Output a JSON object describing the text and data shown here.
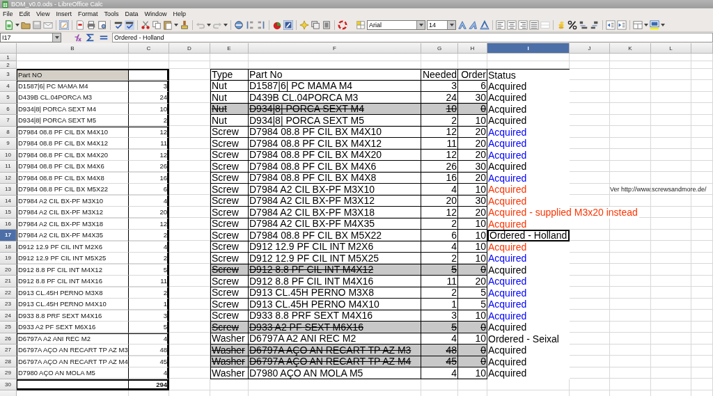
{
  "window": {
    "title": "BOM_v0.0.ods - LibreOffice Calc"
  },
  "menu": [
    "File",
    "Edit",
    "View",
    "Insert",
    "Format",
    "Tools",
    "Data",
    "Window",
    "Help"
  ],
  "formatting": {
    "font": "Arial",
    "size": "14"
  },
  "formula_bar": {
    "cell": "I17",
    "value": "Ordered - Holland"
  },
  "columns": [
    {
      "label": "B",
      "selected": false
    },
    {
      "label": "C",
      "selected": false
    },
    {
      "label": "D",
      "selected": false
    },
    {
      "label": "E",
      "selected": false
    },
    {
      "label": "F",
      "selected": false
    },
    {
      "label": "G",
      "selected": false
    },
    {
      "label": "H",
      "selected": false
    },
    {
      "label": "I",
      "selected": true
    },
    {
      "label": "J",
      "selected": false
    },
    {
      "label": "K",
      "selected": false
    },
    {
      "label": "L",
      "selected": false
    }
  ],
  "rows": [
    {
      "label": "1",
      "selected": false
    },
    {
      "label": "2",
      "selected": false
    },
    {
      "label": "3",
      "selected": false
    },
    {
      "label": "4",
      "selected": false
    },
    {
      "label": "5",
      "selected": false
    },
    {
      "label": "6",
      "selected": false
    },
    {
      "label": "7",
      "selected": false
    },
    {
      "label": "8",
      "selected": false
    },
    {
      "label": "9",
      "selected": false
    },
    {
      "label": "10",
      "selected": false
    },
    {
      "label": "11",
      "selected": false
    },
    {
      "label": "12",
      "selected": false
    },
    {
      "label": "13",
      "selected": false
    },
    {
      "label": "14",
      "selected": false
    },
    {
      "label": "15",
      "selected": false
    },
    {
      "label": "16",
      "selected": false
    },
    {
      "label": "17",
      "selected": true
    },
    {
      "label": "18",
      "selected": false
    },
    {
      "label": "19",
      "selected": false
    },
    {
      "label": "20",
      "selected": false
    },
    {
      "label": "21",
      "selected": false
    },
    {
      "label": "22",
      "selected": false
    },
    {
      "label": "23",
      "selected": false
    },
    {
      "label": "24",
      "selected": false
    },
    {
      "label": "25",
      "selected": false
    },
    {
      "label": "26",
      "selected": false
    },
    {
      "label": "27",
      "selected": false
    },
    {
      "label": "28",
      "selected": false
    },
    {
      "label": "29",
      "selected": false
    },
    {
      "label": "30",
      "selected": false
    }
  ],
  "parts_list": {
    "header": "Part NO",
    "groups": [
      [
        {
          "part": "D1587|6| PC MAMA M4",
          "qty": "3"
        },
        {
          "part": "D439B CL.04PORCA M3",
          "qty": "24"
        },
        {
          "part": "D934|8| PORCA SEXT M4",
          "qty": "10"
        },
        {
          "part": "D934|8| PORCA SEXT M5",
          "qty": "2"
        }
      ],
      [
        {
          "part": "D7984 08.8 PF CIL BX M4X10",
          "qty": "12"
        },
        {
          "part": "D7984 08.8 PF CIL BX M4X12",
          "qty": "11"
        },
        {
          "part": "D7984 08.8 PF CIL BX M4X20",
          "qty": "12"
        },
        {
          "part": "D7984 08.8 PF CIL BX M4X6",
          "qty": "26"
        },
        {
          "part": "D7984 08.8 PF CIL BX M4X8",
          "qty": "16"
        },
        {
          "part": "D7984 08.8 PF CIL BX M5X22",
          "qty": "6"
        },
        {
          "part": "D7984 A2 CIL BX-PF M3X10",
          "qty": "4"
        },
        {
          "part": "D7984 A2 CIL BX-PF M3X12",
          "qty": "20"
        },
        {
          "part": "D7984 A2 CIL BX-PF M3X18",
          "qty": "12"
        },
        {
          "part": "D7984 A2 CIL BX-PF M4X35",
          "qty": "2"
        },
        {
          "part": "D912 12.9 PF CIL INT M2X6",
          "qty": "4"
        },
        {
          "part": "D912 12.9 PF CIL INT M5X25",
          "qty": "2"
        },
        {
          "part": "D912 8.8 PF CIL INT M4X12",
          "qty": "5"
        },
        {
          "part": "D912 8.8 PF CIL INT M4X16",
          "qty": "11"
        },
        {
          "part": "D913 CL.45H PERNO M3X8",
          "qty": "2"
        },
        {
          "part": "D913 CL.45H PERNO M4X10",
          "qty": "1"
        },
        {
          "part": "D933 8.8 PRF SEXT M4X16",
          "qty": "3"
        },
        {
          "part": "D933 A2 PF SEXT M6X16",
          "qty": "5"
        }
      ],
      [
        {
          "part": "D6797A A2 ANI REC M2",
          "qty": "4"
        },
        {
          "part": "D6797A AÇO AN RECART TP AZ M3",
          "qty": "48"
        },
        {
          "part": "D6797A AÇO AN RECART TP AZ M4",
          "qty": "45"
        },
        {
          "part": "D7980 AÇO AN MOLA M5",
          "qty": "4"
        }
      ]
    ],
    "total": "294"
  },
  "orders": {
    "columns": [
      "Type",
      "Part No",
      "Needed",
      "Order",
      "Status"
    ],
    "rows": [
      {
        "type": "Nut",
        "part": "D1587|6| PC MAMA M4",
        "needed": "3",
        "order": "6",
        "status": "Acquired",
        "color": "#000000",
        "struck": false,
        "selected": false
      },
      {
        "type": "Nut",
        "part": "D439B CL.04PORCA M3",
        "needed": "24",
        "order": "30",
        "status": "Acquired",
        "color": "#000000",
        "struck": false,
        "selected": false
      },
      {
        "type": "Nut",
        "part": "D934|8| PORCA SEXT M4",
        "needed": "10",
        "order": "0",
        "status": "Acquired",
        "color": "#000000",
        "struck": true,
        "selected": false
      },
      {
        "type": "Nut",
        "part": "D934|8| PORCA SEXT M5",
        "needed": "2",
        "order": "10",
        "status": "Acquired",
        "color": "#000000",
        "struck": false,
        "selected": false
      },
      {
        "type": "Screw",
        "part": "D7984 08.8 PF CIL BX M4X10",
        "needed": "12",
        "order": "20",
        "status": "Acquired",
        "color": "#0000ff",
        "struck": false,
        "selected": false
      },
      {
        "type": "Screw",
        "part": "D7984 08.8 PF CIL BX M4X12",
        "needed": "11",
        "order": "20",
        "status": "Acquired",
        "color": "#0000ff",
        "struck": false,
        "selected": false
      },
      {
        "type": "Screw",
        "part": "D7984 08.8 PF CIL BX M4X20",
        "needed": "12",
        "order": "20",
        "status": "Acquired",
        "color": "#0000ff",
        "struck": false,
        "selected": false
      },
      {
        "type": "Screw",
        "part": "D7984 08.8 PF CIL BX M4X6",
        "needed": "26",
        "order": "30",
        "status": "Acquired",
        "color": "#000000",
        "struck": false,
        "selected": false
      },
      {
        "type": "Screw",
        "part": "D7984 08.8 PF CIL BX M4X8",
        "needed": "16",
        "order": "20",
        "status": "Acquired",
        "color": "#0000ff",
        "struck": false,
        "selected": false
      },
      {
        "type": "Screw",
        "part": "D7984 A2 CIL BX-PF M3X10",
        "needed": "4",
        "order": "10",
        "status": "Acquired",
        "color": "#ff3300",
        "struck": false,
        "selected": false,
        "note": "Ver http://www.screwsandmore.de/"
      },
      {
        "type": "Screw",
        "part": "D7984 A2 CIL BX-PF M3X12",
        "needed": "20",
        "order": "30",
        "status": "Acquired",
        "color": "#ff3300",
        "struck": false,
        "selected": false
      },
      {
        "type": "Screw",
        "part": "D7984 A2 CIL BX-PF M3X18",
        "needed": "12",
        "order": "20",
        "status": "Acquired - supplied M3x20 instead",
        "color": "#ff3300",
        "struck": false,
        "selected": false
      },
      {
        "type": "Screw",
        "part": "D7984 A2 CIL BX-PF M4X35",
        "needed": "2",
        "order": "10",
        "status": "Acquired",
        "color": "#ff3300",
        "struck": false,
        "selected": false
      },
      {
        "type": "Screw",
        "part": "D7984 08.8 PF CIL BX M5X22",
        "needed": "6",
        "order": "10",
        "status": "Ordered - Holland",
        "color": "#000000",
        "struck": false,
        "selected": true
      },
      {
        "type": "Screw",
        "part": "D912 12.9 PF CIL INT M2X6",
        "needed": "4",
        "order": "10",
        "status": "Acquired",
        "color": "#ff3300",
        "struck": false,
        "selected": false
      },
      {
        "type": "Screw",
        "part": "D912 12.9 PF CIL INT M5X25",
        "needed": "2",
        "order": "10",
        "status": "Acquired",
        "color": "#0000ff",
        "struck": false,
        "selected": false
      },
      {
        "type": "Screw",
        "part": "D912 8.8 PF CIL INT M4X12",
        "needed": "5",
        "order": "0",
        "status": "Acquired",
        "color": "#000000",
        "struck": true,
        "selected": false
      },
      {
        "type": "Screw",
        "part": "D912 8.8 PF CIL INT M4X16",
        "needed": "11",
        "order": "20",
        "status": "Acquired",
        "color": "#0000ff",
        "struck": false,
        "selected": false
      },
      {
        "type": "Screw",
        "part": "D913 CL.45H PERNO M3X8",
        "needed": "2",
        "order": "5",
        "status": "Acquired",
        "color": "#0000ff",
        "struck": false,
        "selected": false
      },
      {
        "type": "Screw",
        "part": "D913 CL.45H PERNO M4X10",
        "needed": "1",
        "order": "5",
        "status": "Acquired",
        "color": "#0000ff",
        "struck": false,
        "selected": false
      },
      {
        "type": "Screw",
        "part": "D933 8.8 PRF SEXT M4X16",
        "needed": "3",
        "order": "10",
        "status": "Acquired",
        "color": "#0000ff",
        "struck": false,
        "selected": false
      },
      {
        "type": "Screw",
        "part": "D933 A2 PF SEXT M6X16",
        "needed": "5",
        "order": "0",
        "status": "Acquired",
        "color": "#000000",
        "struck": true,
        "selected": false
      },
      {
        "type": "Washer",
        "part": "D6797A A2 ANI REC M2",
        "needed": "4",
        "order": "10",
        "status": "Ordered - Seixal",
        "color": "#000000",
        "struck": false,
        "selected": false
      },
      {
        "type": "Washer",
        "part": "D6797A AÇO AN RECART TP AZ M3",
        "needed": "48",
        "order": "0",
        "status": "Acquired",
        "color": "#000000",
        "struck": true,
        "selected": false
      },
      {
        "type": "Washer",
        "part": "D6797A AÇO AN RECART TP AZ M4",
        "needed": "45",
        "order": "0",
        "status": "Acquired",
        "color": "#000000",
        "struck": true,
        "selected": false
      },
      {
        "type": "Washer",
        "part": "D7980 AÇO AN MOLA M5",
        "needed": "4",
        "order": "10",
        "status": "Acquired",
        "color": "#000000",
        "struck": false,
        "selected": false
      }
    ]
  }
}
